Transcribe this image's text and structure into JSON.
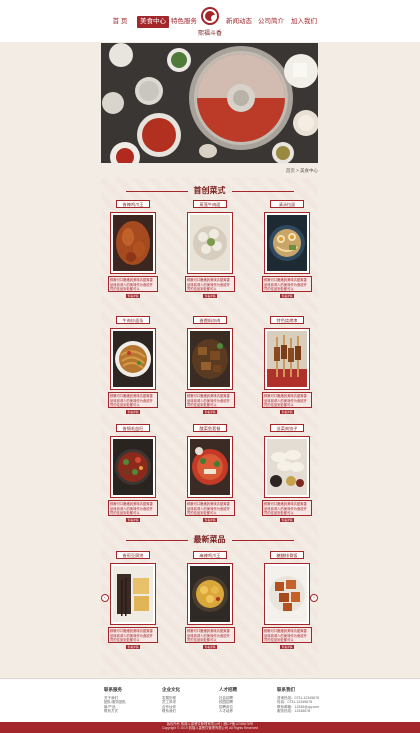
{
  "nav": {
    "items": [
      {
        "label": "首  页",
        "active": false
      },
      {
        "label": "美食中心",
        "active": true
      },
      {
        "label": "特色服务",
        "active": false
      },
      {
        "label": "新闻动态",
        "active": false
      },
      {
        "label": "公司简介",
        "active": false
      },
      {
        "label": "加入我们",
        "active": false
      }
    ],
    "logo_text": "熙福斗香"
  },
  "breadcrumb": "首页 > 美食中心",
  "sections": {
    "first": "首创菜式",
    "latest": "最新菜品"
  },
  "card_desc": "鲜嫩可口脆嫩其美味清甜爽香品味到诱人的美味作为食欲开胃的佳品到处都可以",
  "card_more": "查看详情",
  "first_dishes": [
    {
      "name": "香辣鸡爪王"
    },
    {
      "name": "蒸笼牛肉面"
    },
    {
      "name": "清汤拉面"
    },
    {
      "name": "牛肉炒面条"
    },
    {
      "name": "香煨焖炒肉"
    },
    {
      "name": "特色烧烤串"
    },
    {
      "name": "香锅毛血旺"
    },
    {
      "name": "酸菜鱼套餐"
    },
    {
      "name": "韭菜肉饺子"
    }
  ],
  "latest_dishes": [
    {
      "name": "香煎豆腐饼"
    },
    {
      "name": "麻辣鸡爪王"
    },
    {
      "name": "糖醋排骨饭"
    }
  ],
  "footer": {
    "cols": [
      {
        "title": "联系服务",
        "items": [
          "关于我们",
          "团队/服务团队",
          "新/产品",
          "联系方式"
        ]
      },
      {
        "title": "企业文化",
        "items": [
          "发展历程",
          "员工风采",
          "合作伙伴",
          "联系我们"
        ]
      },
      {
        "title": "人才招聘",
        "items": [
          "社会招聘",
          "校园招聘",
          "招聘岗位",
          "人才培养"
        ]
      },
      {
        "title": "联系我们",
        "items": [
          "咨询热线：0731-12345678",
          "传真：0731-12345678",
          "联系邮箱：12345@qq.com",
          "服务热线：12345678"
        ]
      }
    ]
  },
  "copyright": {
    "line1": "版权所有 熙福斗香餐饮管理有限公司 | 湘ICP备12345678号",
    "line2": "Copyright © 2019 熙福斗香餐饮管理有限公司 All Rights Reserved"
  }
}
